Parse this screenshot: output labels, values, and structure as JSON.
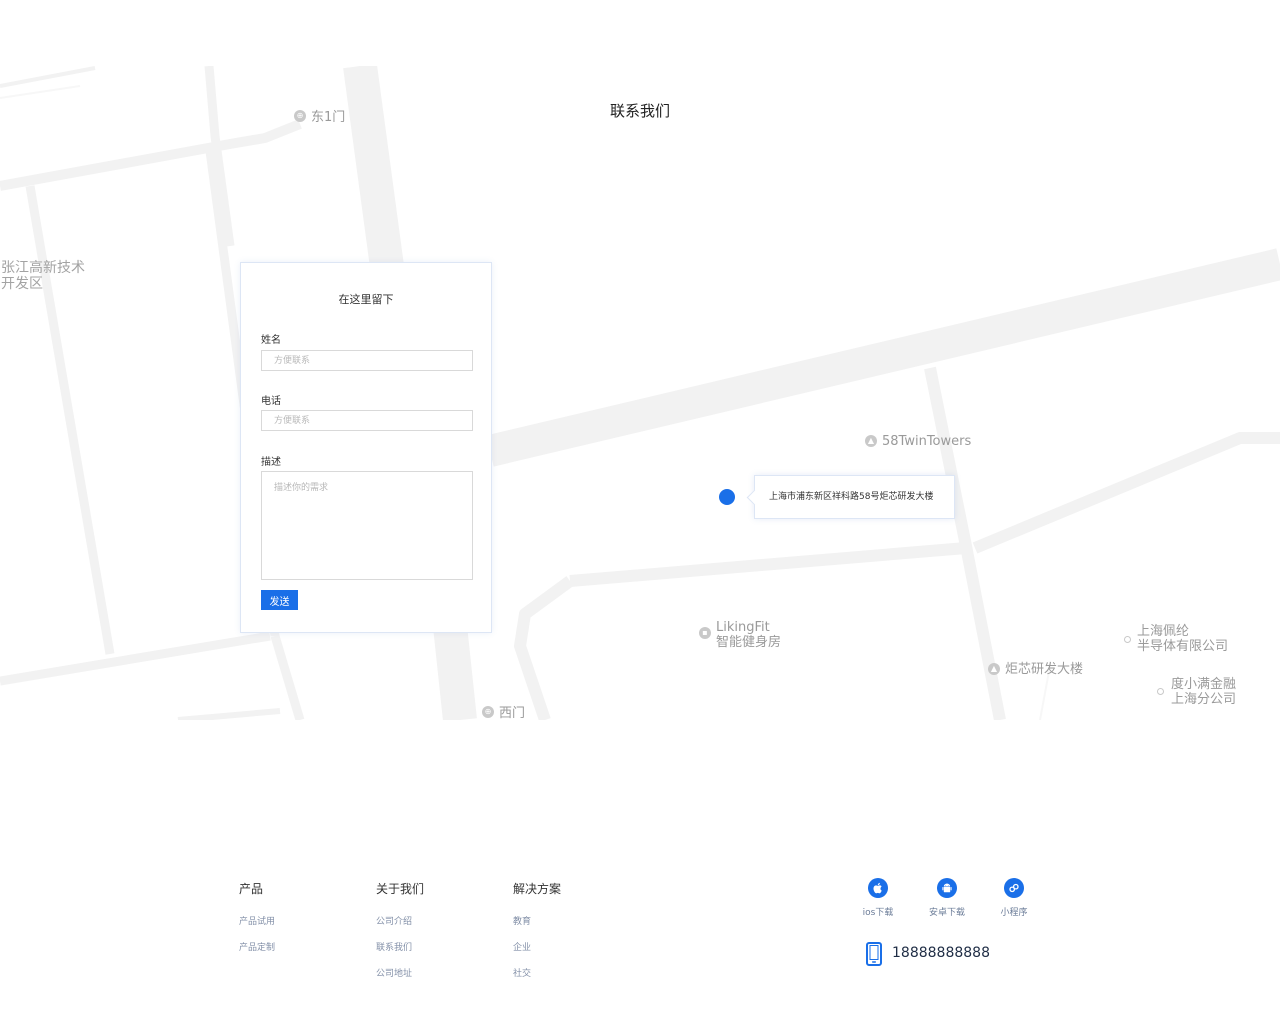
{
  "section": {
    "title": "联系我们"
  },
  "map": {
    "labels": {
      "east_gate": "东1门",
      "zone_line1": "张江高新技术",
      "zone_line2": "开发区",
      "twin_towers": "58TwinTowers",
      "likingfit_line1": "LikingFit",
      "likingfit_line2": "智能健身房",
      "juxin": "炬芯研发大楼",
      "peilun_line1": "上海佩纶",
      "peilun_line2": "半导体有限公司",
      "duxiaoman_line1": "度小满金融",
      "duxiaoman_line2": "上海分公司",
      "west_gate": "西门"
    },
    "address": "上海市浦东新区祥科路58号炬芯研发大楼"
  },
  "form": {
    "title": "在这里留下",
    "name_label": "姓名",
    "name_placeholder": "方便联系",
    "phone_label": "电话",
    "phone_placeholder": "方便联系",
    "desc_label": "描述",
    "desc_placeholder": "描述你的需求",
    "submit_label": "发送"
  },
  "footer": {
    "columns": [
      {
        "title": "产品",
        "links": [
          "产品试用",
          "产品定制"
        ]
      },
      {
        "title": "关于我们",
        "links": [
          "公司介绍",
          "联系我们",
          "公司地址"
        ]
      },
      {
        "title": "解决方案",
        "links": [
          "教育",
          "企业",
          "社交"
        ]
      }
    ],
    "apps": [
      {
        "label": "ios下载",
        "icon": "apple-icon"
      },
      {
        "label": "安卓下载",
        "icon": "android-icon"
      },
      {
        "label": "小程序",
        "icon": "mini-program-icon"
      }
    ],
    "phone": "18888888888"
  },
  "colors": {
    "accent": "#1a6fe8",
    "road": "#f3f3f3",
    "text_muted": "#8390a8"
  }
}
